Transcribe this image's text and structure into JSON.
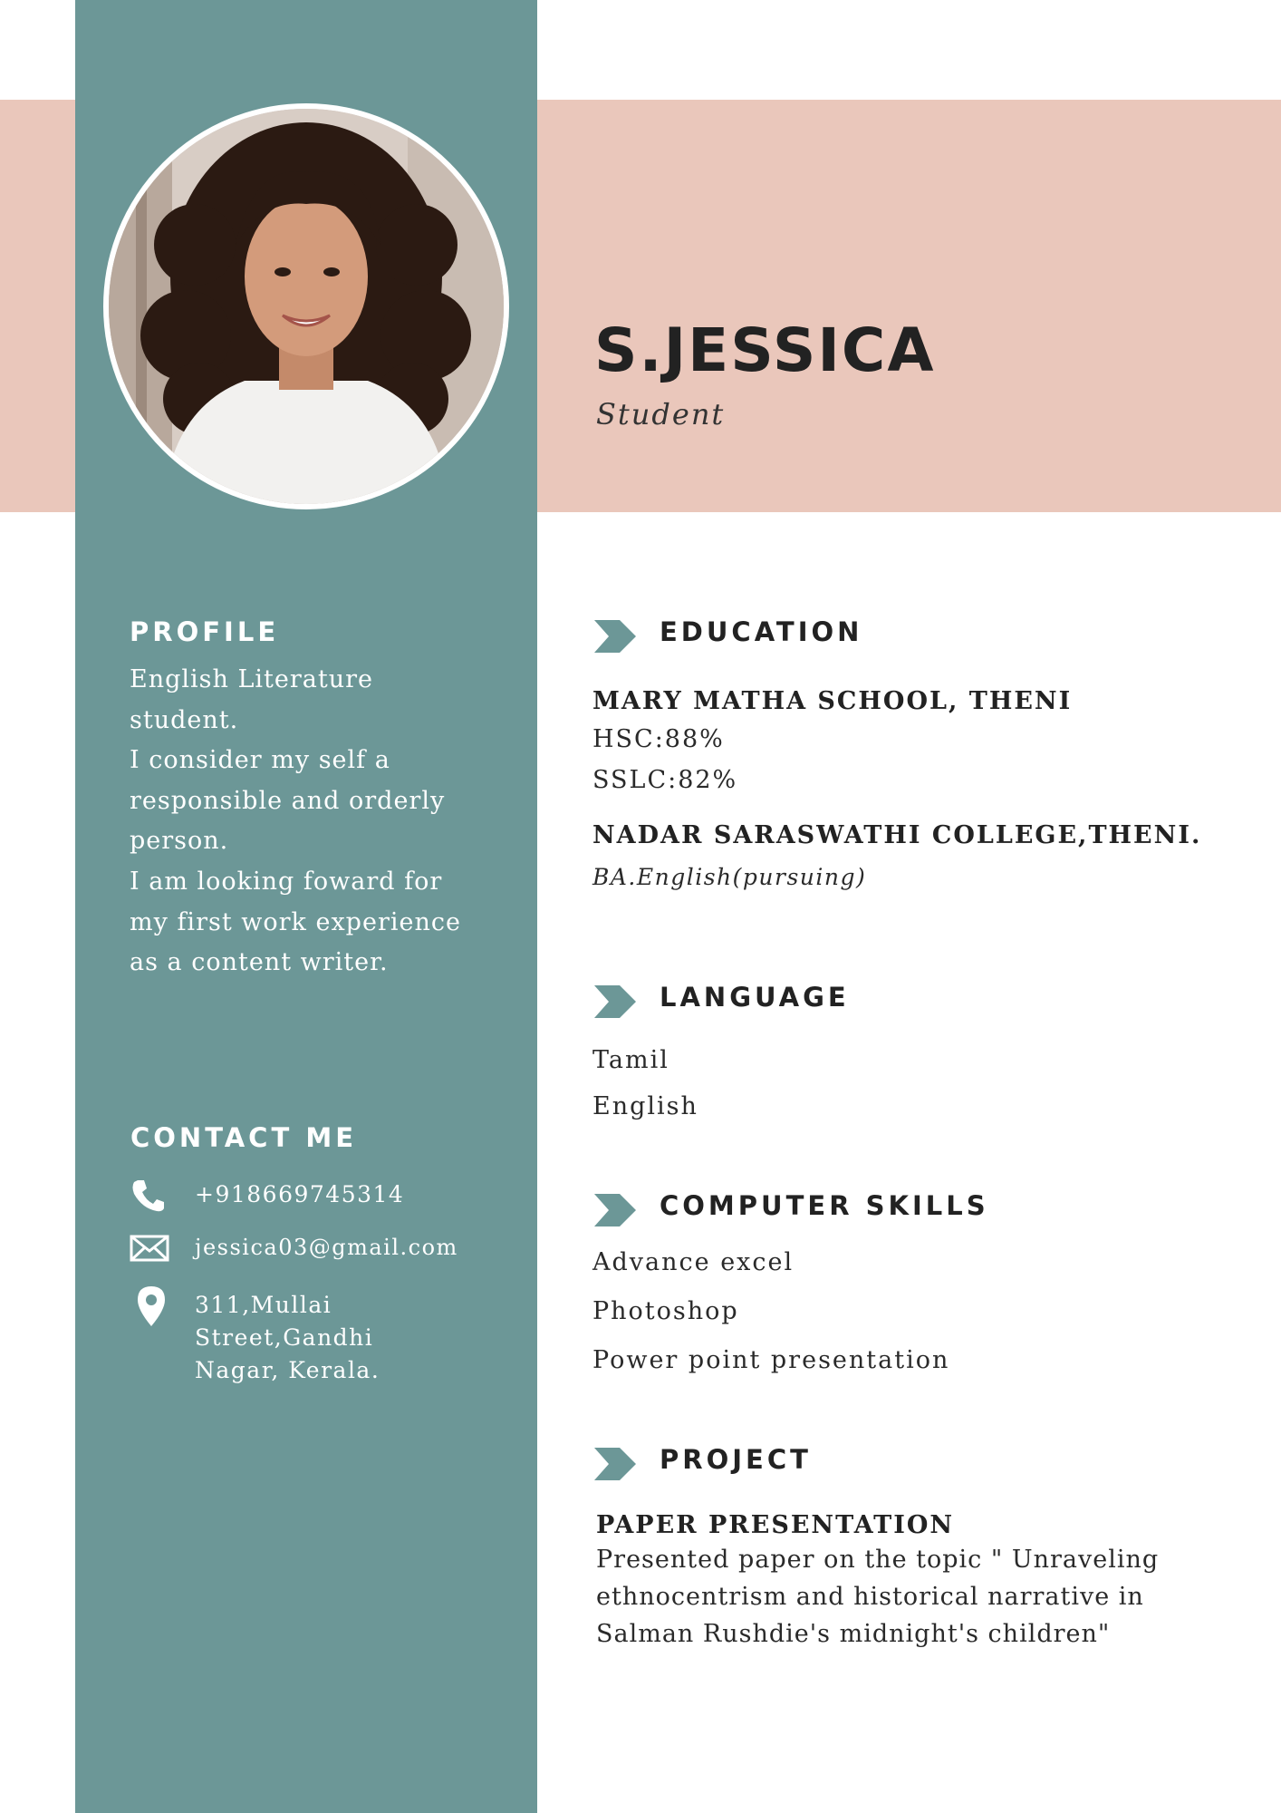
{
  "header": {
    "name": "S.JESSICA",
    "role": "Student"
  },
  "profile": {
    "heading": "PROFILE",
    "lines": [
      "English Literature",
      "student.",
      "I consider my self a",
      "responsible and orderly",
      "person.",
      "I am looking foward for",
      "my first work experience",
      "as a content writer."
    ]
  },
  "contact": {
    "heading": "CONTACT ME",
    "phone": "+918669745314",
    "email": "jessica03@gmail.com",
    "address_lines": [
      "311,Mullai",
      "Street,Gandhi",
      "Nagar, Kerala."
    ],
    "icons": [
      "phone-icon",
      "mail-icon",
      "location-pin-icon"
    ]
  },
  "education": {
    "heading": "EDUCATION",
    "school": "MARY MATHA SCHOOL, THENI",
    "hsc": "HSC:88%",
    "sslc": "SSLC:82%",
    "college": "NADAR SARASWATHI COLLEGE,THENI.",
    "degree": "BA.English(pursuing)"
  },
  "language": {
    "heading": "LANGUAGE",
    "items": [
      "Tamil",
      "English"
    ]
  },
  "skills": {
    "heading": "COMPUTER SKILLS",
    "items": [
      "Advance excel",
      "Photoshop",
      "Power point presentation"
    ]
  },
  "project": {
    "heading": "PROJECT",
    "title": "PAPER PRESENTATION",
    "description_lines": [
      "Presented paper on the topic \" Unraveling",
      "ethnocentrism and historical narrative in",
      "Salman Rushdie's midnight's children\""
    ]
  },
  "colors": {
    "sidebar": "#6c9797",
    "band": "#eac7bb",
    "accent_arrow": "#6c9797",
    "text_dark": "#222222"
  }
}
